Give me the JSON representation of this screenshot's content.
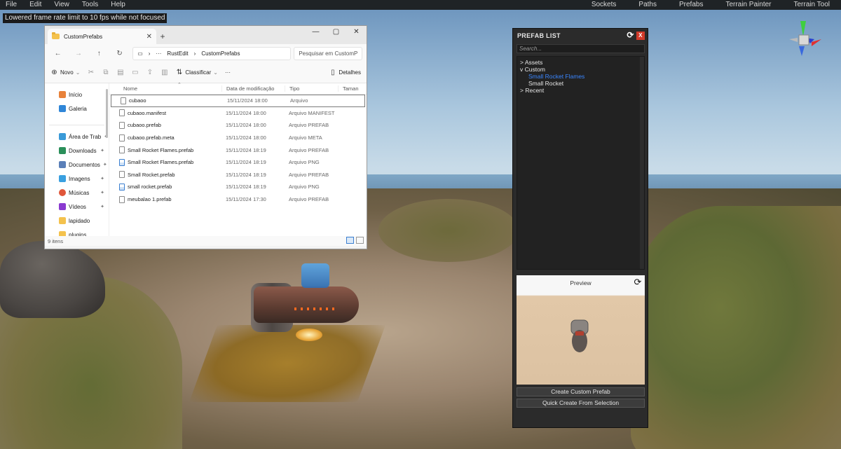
{
  "menubar": {
    "left": [
      "File",
      "Edit",
      "View",
      "Tools",
      "Help"
    ],
    "right": [
      "Sockets",
      "Paths",
      "Prefabs",
      "Terrain Painter",
      "Terrain Tool"
    ]
  },
  "fps_note": "Lowered frame rate limit to 10 fps while not focused",
  "explorer": {
    "tab_title": "CustomPrefabs",
    "breadcrumb": [
      "RustEdit",
      "CustomPrefabs"
    ],
    "search_placeholder": "Pesquisar em CustomP",
    "toolbar": {
      "new_label": "Novo",
      "sort_label": "Classificar",
      "details_label": "Detalhes",
      "more_label": "···"
    },
    "sidebar": {
      "items": [
        {
          "label": "Início",
          "icon": "home-icon",
          "pinned": false
        },
        {
          "label": "Galeria",
          "icon": "gallery-icon",
          "pinned": false
        },
        {
          "label": "Área de Trab",
          "icon": "desktop-icon",
          "pinned": true
        },
        {
          "label": "Downloads",
          "icon": "download-icon",
          "pinned": true
        },
        {
          "label": "Documentos",
          "icon": "documents-icon",
          "pinned": true
        },
        {
          "label": "Imagens",
          "icon": "pictures-icon",
          "pinned": true
        },
        {
          "label": "Músicas",
          "icon": "music-icon",
          "pinned": true
        },
        {
          "label": "Vídeos",
          "icon": "videos-icon",
          "pinned": true
        },
        {
          "label": "lapidado",
          "icon": "folder-icon",
          "pinned": false
        },
        {
          "label": "plugins",
          "icon": "folder-icon",
          "pinned": false
        }
      ]
    },
    "columns": [
      "Nome",
      "Data de modificação",
      "Tipo",
      "Taman"
    ],
    "files": [
      {
        "name": "cubaoo",
        "date": "15/11/2024 18:00",
        "type": "Arquivo",
        "kind": "doc"
      },
      {
        "name": "cubaoo.manifest",
        "date": "15/11/2024 18:00",
        "type": "Arquivo MANIFEST",
        "kind": "doc"
      },
      {
        "name": "cubaoo.prefab",
        "date": "15/11/2024 18:00",
        "type": "Arquivo PREFAB",
        "kind": "doc"
      },
      {
        "name": "cubaoo.prefab.meta",
        "date": "15/11/2024 18:00",
        "type": "Arquivo META",
        "kind": "doc"
      },
      {
        "name": "Small Rocket Flames.prefab",
        "date": "15/11/2024 18:19",
        "type": "Arquivo PREFAB",
        "kind": "doc"
      },
      {
        "name": "Small Rocket Flames.prefab",
        "date": "15/11/2024 18:19",
        "type": "Arquivo PNG",
        "kind": "img"
      },
      {
        "name": "Small Rocket.prefab",
        "date": "15/11/2024 18:19",
        "type": "Arquivo PREFAB",
        "kind": "doc"
      },
      {
        "name": "small rocket.prefab",
        "date": "15/11/2024 18:19",
        "type": "Arquivo PNG",
        "kind": "img"
      },
      {
        "name": "meubalao 1.prefab",
        "date": "15/11/2024 17:30",
        "type": "Arquivo PREFAB",
        "kind": "doc"
      }
    ],
    "status": "9 itens"
  },
  "prefab_panel": {
    "title": "PREFAB LIST",
    "close_label": "X",
    "search_placeholder": "Search...",
    "tree": [
      {
        "label": "> Assets",
        "level": 1,
        "active": false
      },
      {
        "label": "v Custom",
        "level": 1,
        "active": false
      },
      {
        "label": "Small Rocket Flames",
        "level": 2,
        "active": true
      },
      {
        "label": "Small Rocket",
        "level": 2,
        "active": false
      },
      {
        "label": "> Recent",
        "level": 1,
        "active": false
      }
    ],
    "preview_label": "Preview",
    "create_button": "Create Custom Prefab",
    "quick_create_button": "Quick Create From Selection"
  },
  "colors": {
    "accent_blue": "#3a86ff",
    "close_red": "#d23a2a",
    "panel_bg": "#2b2b2b"
  }
}
